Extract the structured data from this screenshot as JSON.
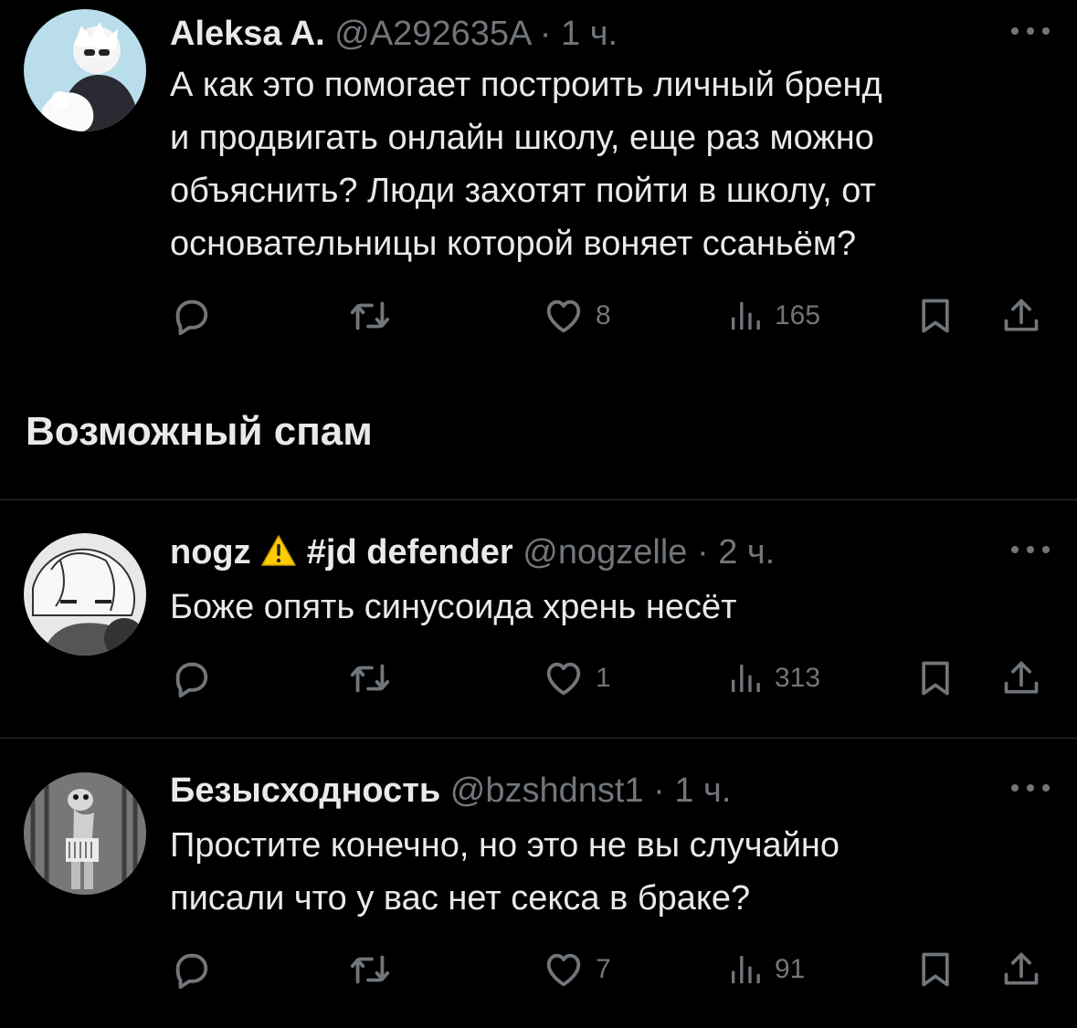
{
  "tweets": [
    {
      "name": "Aleksa A.",
      "handle": "@A292635A",
      "time": "· 1 ч.",
      "text": "А как это помогает построить личный бренд\nи продвигать онлайн школу, еще раз можно\nобъяснить? Люди захотят пойти в школу, от\nосновательницы которой воняет ссаньём?",
      "likes": "8",
      "views": "165"
    },
    {
      "name": "nogz",
      "name_suffix": "#jd defender",
      "handle": "@nogzelle",
      "time": "· 2 ч.",
      "text": "Боже опять синусоида хрень несёт",
      "likes": "1",
      "views": "313"
    },
    {
      "name": "Безысходность",
      "handle": "@bzshdnst1",
      "time": "· 1 ч.",
      "text": "Простите конечно, но это не вы случайно\nписали что у вас нет секса в браке?",
      "likes": "7",
      "views": "91"
    }
  ],
  "section": {
    "title": "Возможный спам"
  },
  "icons": [
    "reply-icon",
    "retweet-icon",
    "heart-icon",
    "views-icon",
    "bookmark-icon",
    "share-icon",
    "more-icon",
    "warning-icon"
  ],
  "colors": {
    "background": "#000000",
    "text": "#e7e9ea",
    "muted": "#71767b",
    "divider": "#2f3336",
    "warning": "#ffcc00"
  }
}
